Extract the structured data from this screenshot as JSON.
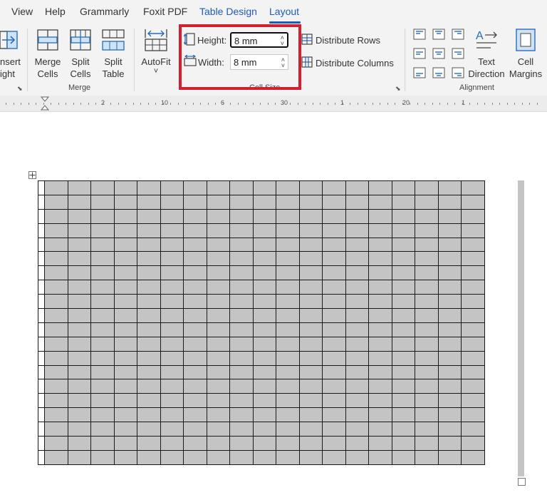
{
  "menu": {
    "items": [
      "View",
      "Help",
      "Grammarly",
      "Foxit PDF",
      "Table Design",
      "Layout"
    ],
    "active": "Layout"
  },
  "ribbon": {
    "insert_right": {
      "line1": "nsert",
      "line2": "ight"
    },
    "merge_cells": {
      "line1": "Merge",
      "line2": "Cells"
    },
    "split_cells": {
      "line1": "Split",
      "line2": "Cells"
    },
    "split_table": {
      "line1": "Split",
      "line2": "Table"
    },
    "autofit": {
      "label": "AutoFit",
      "chevron": "˅"
    },
    "height": {
      "label": "Height:",
      "value": "8 mm"
    },
    "width": {
      "label": "Width:",
      "value": "8 mm"
    },
    "distribute_rows": "Distribute Rows",
    "distribute_columns": "Distribute Columns",
    "text_direction": {
      "line1": "Text",
      "line2": "Direction"
    },
    "cell_margins": {
      "line1": "Cell",
      "line2": "Margins"
    },
    "groups": {
      "merge": "Merge",
      "cell_size": "Cell Size",
      "alignment": "Alignment"
    }
  },
  "ruler": {
    "labels": [
      "2",
      "10",
      "6",
      "30",
      "1",
      "20",
      "1"
    ]
  },
  "table": {
    "rows": 20,
    "columns": 20
  },
  "colors": {
    "accent": "#1e5bb8",
    "highlight": "#d2202f",
    "cell_fill": "#c4c4c4"
  }
}
